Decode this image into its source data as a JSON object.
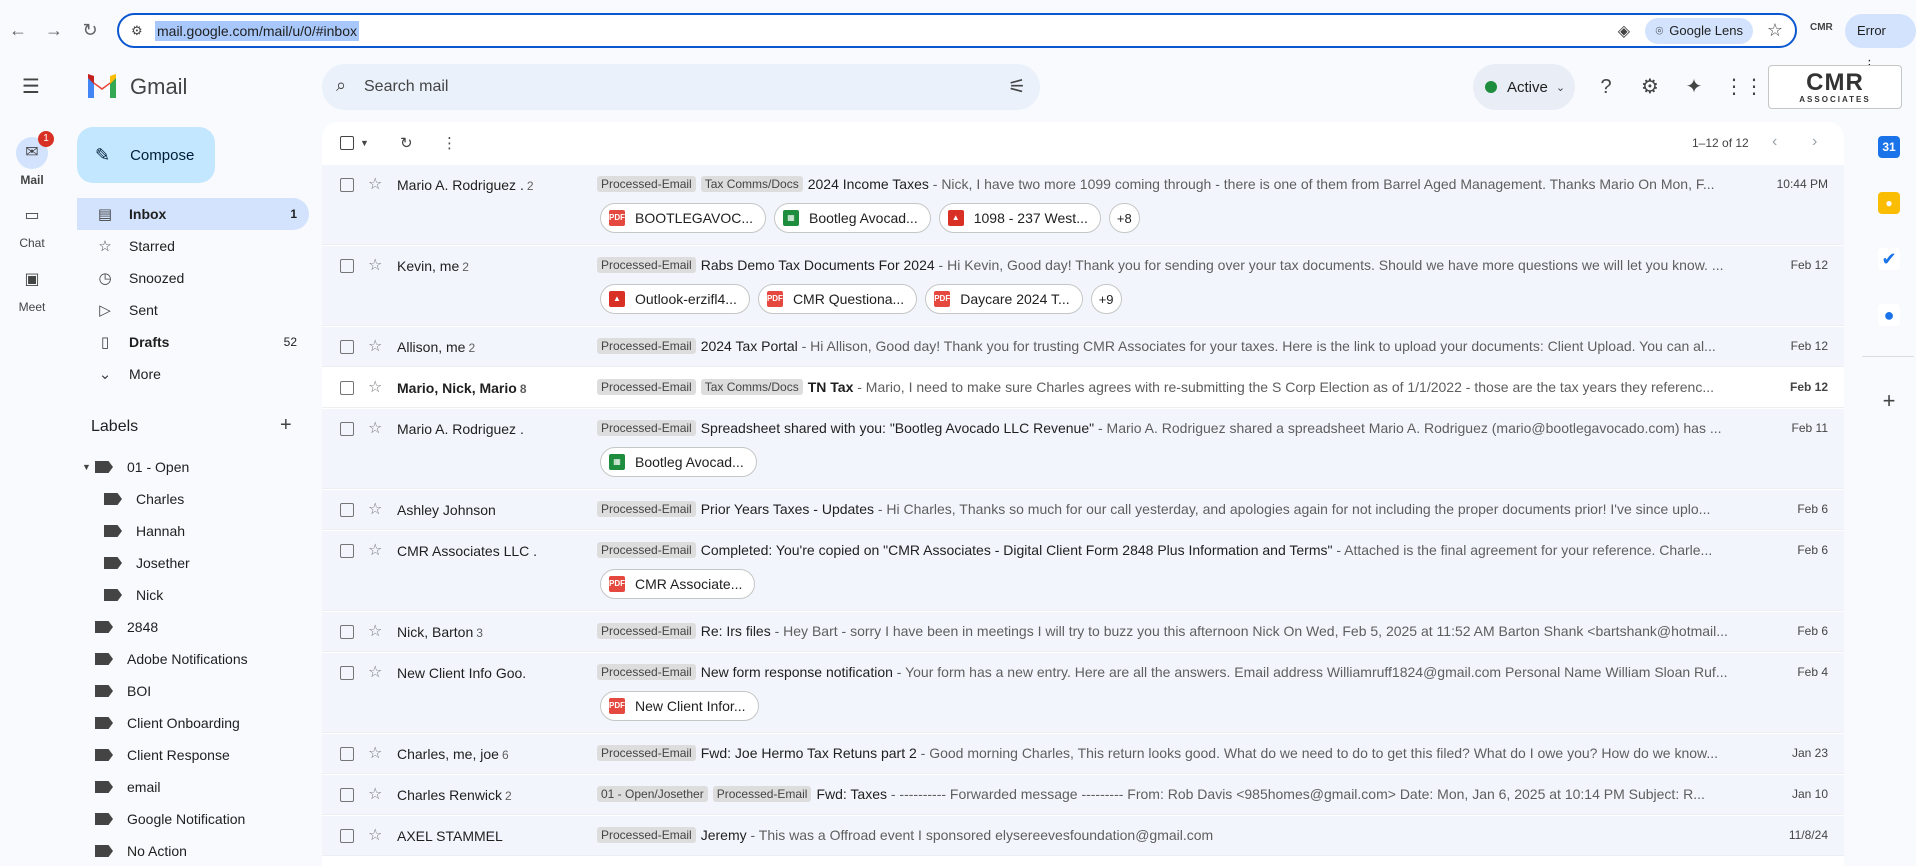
{
  "browser": {
    "url": "mail.google.com/mail/u/0/#inbox",
    "lens_label": "Google Lens",
    "error_label": "Error",
    "profile_text": "CMR"
  },
  "header": {
    "app_name": "Gmail",
    "search_placeholder": "Search mail",
    "status_label": "Active",
    "brand_logo_text": "CMR",
    "brand_logo_sub": "ASSOCIATES"
  },
  "rail": [
    {
      "label": "Mail",
      "icon": "mail-icon",
      "badge": "1"
    },
    {
      "label": "Chat",
      "icon": "chat-icon"
    },
    {
      "label": "Meet",
      "icon": "meet-icon"
    }
  ],
  "compose_label": "Compose",
  "nav": [
    {
      "label": "Inbox",
      "count": "1",
      "icon": "inbox-icon"
    },
    {
      "label": "Starred",
      "count": "",
      "icon": "star-icon"
    },
    {
      "label": "Snoozed",
      "count": "",
      "icon": "clock-icon"
    },
    {
      "label": "Sent",
      "count": "",
      "icon": "send-icon"
    },
    {
      "label": "Drafts",
      "count": "52",
      "icon": "draft-icon"
    },
    {
      "label": "More",
      "count": "",
      "icon": "chevron-down-icon"
    }
  ],
  "labels_title": "Labels",
  "labels": [
    {
      "name": "01 - Open"
    },
    {
      "name": "Charles"
    },
    {
      "name": "Hannah"
    },
    {
      "name": "Josether"
    },
    {
      "name": "Nick"
    },
    {
      "name": "2848"
    },
    {
      "name": "Adobe Notifications"
    },
    {
      "name": "BOI"
    },
    {
      "name": "Client Onboarding"
    },
    {
      "name": "Client Response"
    },
    {
      "name": "email"
    },
    {
      "name": "Google Notification"
    },
    {
      "name": "No Action"
    }
  ],
  "toolbar": {
    "page_info": "1–12 of 12"
  },
  "emails": [
    {
      "sender": "Mario A. Rodriguez .",
      "count": "2",
      "labels": [
        "Processed-Email",
        "Tax Comms/Docs"
      ],
      "subject": "2024 Income Taxes",
      "snippet": " - Nick, I have two more 1099 coming through - there is one of them from Barrel Aged Management. Thanks Mario On Mon, F...",
      "date": "10:44 PM",
      "unread": false,
      "attachments": [
        {
          "type": "pdf",
          "name": "BOOTLEGAVOC..."
        },
        {
          "type": "sheet",
          "name": "Bootleg Avocad..."
        },
        {
          "type": "img",
          "name": "1098 - 237 West..."
        }
      ],
      "more": "+8"
    },
    {
      "sender": "Kevin, me",
      "count": "2",
      "labels": [
        "Processed-Email"
      ],
      "subject": "Rabs Demo Tax Documents For 2024",
      "snippet": " - Hi Kevin, Good day! Thank you for sending over your tax documents. Should we have more questions we will let you know. ...",
      "date": "Feb 12",
      "unread": false,
      "attachments": [
        {
          "type": "img",
          "name": "Outlook-erzifl4..."
        },
        {
          "type": "pdf",
          "name": "CMR Questiona..."
        },
        {
          "type": "pdf",
          "name": "Daycare 2024 T..."
        }
      ],
      "more": "+9"
    },
    {
      "sender": "Allison, me",
      "count": "2",
      "labels": [
        "Processed-Email"
      ],
      "subject": "2024 Tax Portal",
      "snippet": " - Hi Allison, Good day! Thank you for trusting CMR Associates for your taxes. Here is the link to upload your documents: Client Upload. You can al...",
      "date": "Feb 12",
      "unread": false,
      "attachments": [],
      "more": ""
    },
    {
      "sender_parts": [
        "Mario, ",
        "Nick",
        ", ",
        "Mario"
      ],
      "count": "8",
      "labels": [
        "Processed-Email",
        "Tax Comms/Docs"
      ],
      "subject": "TN Tax",
      "snippet": " - Mario, I need to make sure Charles agrees with re-submitting the S Corp Election as of 1/1/2022 - those are the tax years they referenc...",
      "date": "Feb 12",
      "unread": true,
      "attachments": [],
      "more": ""
    },
    {
      "sender": "Mario A. Rodriguez .",
      "count": "",
      "labels": [
        "Processed-Email"
      ],
      "subject": "Spreadsheet shared with you: \"Bootleg Avocado LLC Revenue\"",
      "snippet": " - Mario A. Rodriguez shared a spreadsheet Mario A. Rodriguez (mario@bootlegavocado.com) has ...",
      "date": "Feb 11",
      "unread": false,
      "attachments": [
        {
          "type": "sheet",
          "name": "Bootleg Avocad..."
        }
      ],
      "more": ""
    },
    {
      "sender": "Ashley Johnson",
      "count": "",
      "labels": [
        "Processed-Email"
      ],
      "subject": "Prior Years Taxes - Updates",
      "snippet": " - Hi Charles, Thanks so much for our call yesterday, and apologies again for not including the proper documents prior! I've since uplo...",
      "date": "Feb 6",
      "unread": false,
      "attachments": [],
      "more": ""
    },
    {
      "sender": "CMR Associates LLC .",
      "count": "",
      "labels": [
        "Processed-Email"
      ],
      "subject": "Completed: You're copied on \"CMR Associates - Digital Client Form 2848 Plus Information and Terms\"",
      "snippet": " - Attached is the final agreement for your reference. Charle...",
      "date": "Feb 6",
      "unread": false,
      "attachments": [
        {
          "type": "pdf",
          "name": "CMR Associate..."
        }
      ],
      "more": ""
    },
    {
      "sender": "Nick, Barton",
      "count": "3",
      "labels": [
        "Processed-Email"
      ],
      "subject": "Re: Irs files",
      "snippet": " - Hey Bart - sorry I have been in meetings I will try to buzz you this afternoon Nick On Wed, Feb 5, 2025 at 11:52 AM Barton Shank <bartshank@hotmail...",
      "date": "Feb 6",
      "unread": false,
      "attachments": [],
      "more": ""
    },
    {
      "sender": "New Client Info Goo.",
      "count": "",
      "labels": [
        "Processed-Email"
      ],
      "subject": "New form response notification",
      "snippet": " - Your form has a new entry. Here are all the answers. Email address Williamruff1824@gmail.com Personal Name William Sloan Ruf...",
      "date": "Feb 4",
      "unread": false,
      "attachments": [
        {
          "type": "pdf",
          "name": "New Client Infor..."
        }
      ],
      "more": ""
    },
    {
      "sender": "Charles, me, joe",
      "count": "6",
      "labels": [
        "Processed-Email"
      ],
      "subject": "Fwd: Joe Hermo Tax Retuns part 2",
      "snippet": " - Good morning Charles, This return looks good. What do we need to do to get this filed? What do I owe you? How do we know...",
      "date": "Jan 23",
      "unread": false,
      "attachments": [],
      "more": ""
    },
    {
      "sender": "Charles Renwick",
      "count": "2",
      "labels": [
        "01 - Open/Josether",
        "Processed-Email"
      ],
      "subject": "Fwd: Taxes",
      "snippet": " - ---------- Forwarded message --------- From: Rob Davis <985homes@gmail.com> Date: Mon, Jan 6, 2025 at 10:14 PM Subject: R...",
      "date": "Jan 10",
      "unread": false,
      "attachments": [],
      "more": ""
    },
    {
      "sender": "AXEL STAMMEL",
      "count": "",
      "labels": [
        "Processed-Email"
      ],
      "subject": "Jeremy",
      "snippet": " - This was a Offroad event I sponsored elysereevesfoundation@gmail.com",
      "date": "11/8/24",
      "unread": false,
      "attachments": [],
      "more": ""
    }
  ],
  "side_panel": [
    {
      "icon": "calendar-icon",
      "text": "31"
    },
    {
      "icon": "keep-icon",
      "text": ""
    },
    {
      "icon": "tasks-icon",
      "text": ""
    },
    {
      "icon": "contacts-icon",
      "text": ""
    }
  ]
}
